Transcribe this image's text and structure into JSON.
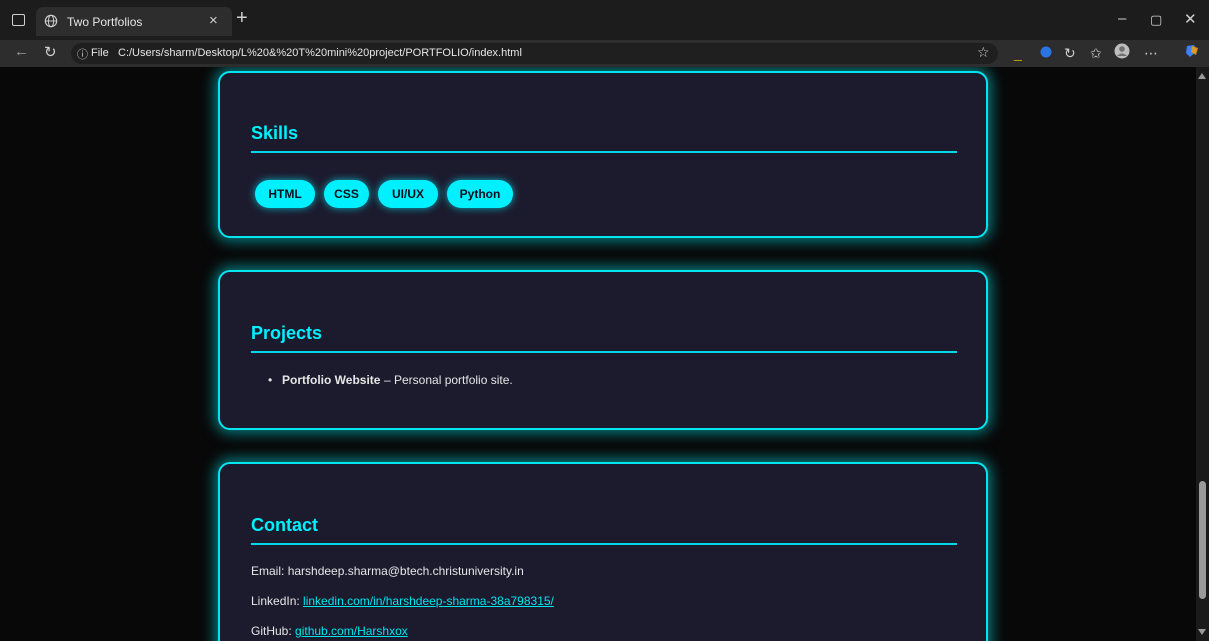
{
  "browser": {
    "tab_title": "Two Portfolios",
    "tab_close": "×",
    "new_tab": "+",
    "address": {
      "info_glyph": "ⓘ",
      "scheme_label": "File",
      "url": "C:/Users/sharm/Desktop/L%20&%20T%20mini%20project/PORTFOLIO/index.html"
    },
    "icons": [
      "sidebar-toggle-icon",
      "globe-icon",
      "back-icon",
      "refresh-icon",
      "star-icon",
      "extension-icon",
      "refresh-alt-icon",
      "favorites-icon",
      "profile-icon",
      "more-icon",
      "copilot-icon"
    ],
    "window_controls": {
      "minimize": "–",
      "maximize": "▢",
      "close": "✕"
    }
  },
  "skills": {
    "heading": "Skills",
    "items": [
      "HTML",
      "CSS",
      "UI/UX",
      "Python"
    ]
  },
  "projects": {
    "heading": "Projects",
    "items": [
      {
        "name": "Portfolio Website",
        "description": "– Personal portfolio site."
      }
    ]
  },
  "contact": {
    "heading": "Contact",
    "email_label": "Email:",
    "email_value": "harshdeep.sharma@btech.christuniversity.in",
    "linkedin_label": "LinkedIn:",
    "linkedin_value": "linkedin.com/in/harshdeep-sharma-38a798315/",
    "github_label": "GitHub:",
    "github_value": "github.com/Harshxox"
  },
  "colors": {
    "accent": "#00f0ff",
    "card_bg": "#1c1b2e",
    "page_bg": "#080808"
  }
}
